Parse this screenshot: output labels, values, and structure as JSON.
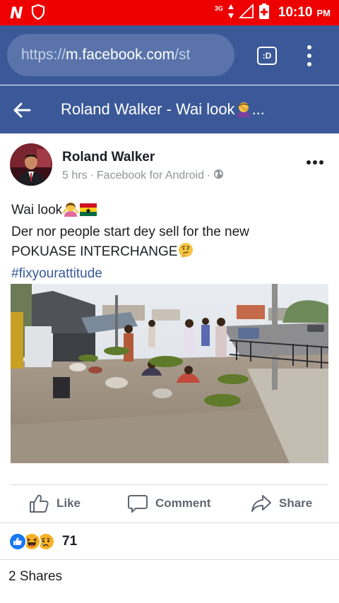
{
  "status_bar": {
    "network": "3G",
    "time": "10:10",
    "ampm": "PM"
  },
  "browser": {
    "url_scheme": "https://",
    "url_host": "m.facebook.com",
    "url_path": "/st",
    "tabs_label": ":D"
  },
  "header": {
    "title": "Roland Walker - Wai look",
    "ellipsis": "..."
  },
  "post": {
    "author": "Roland Walker",
    "time": "5 hrs",
    "source": "Facebook for Android",
    "line1": "Wai look",
    "line2": "Der nor people start dey sell for the new",
    "line3": "POKUASE INTERCHANGE",
    "hashtag": "#fixyourattitude"
  },
  "actions": {
    "like": "Like",
    "comment": "Comment",
    "share": "Share"
  },
  "reactions": {
    "count": "71",
    "types": [
      "like",
      "haha",
      "sad"
    ]
  },
  "shares_text": "2 Shares",
  "colors": {
    "status_bar": "#ee0000",
    "facebook_blue": "#3b5998",
    "url_box": "#5a74ab",
    "hashtag": "#385898",
    "action_gray": "#606770"
  }
}
